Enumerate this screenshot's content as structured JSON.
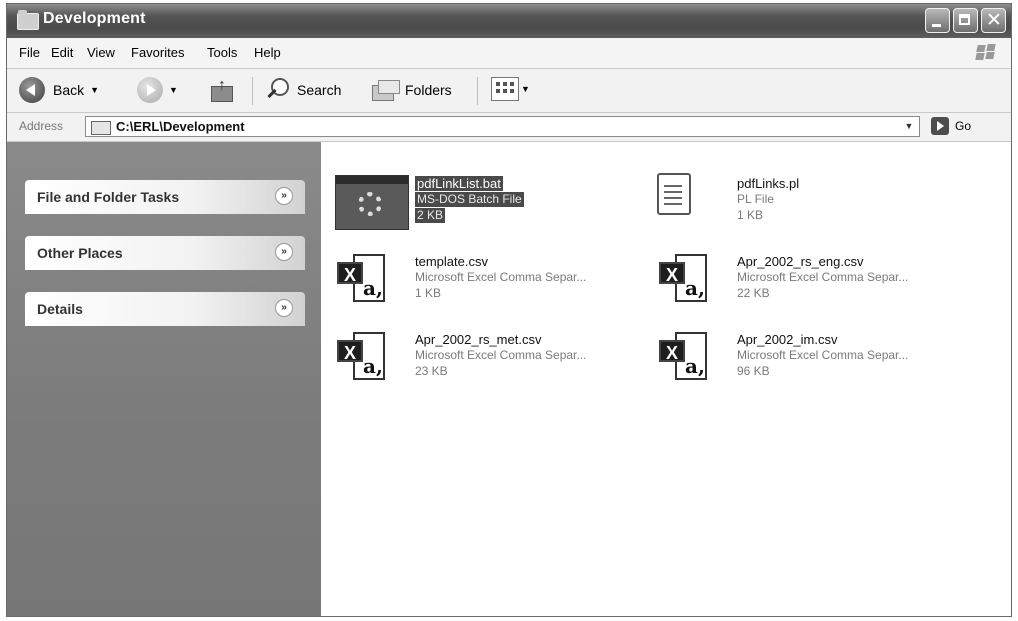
{
  "window": {
    "title": "Development"
  },
  "menu": [
    "File",
    "Edit",
    "View",
    "Favorites",
    "Tools",
    "Help"
  ],
  "toolbar": {
    "back": "Back",
    "search": "Search",
    "folders": "Folders"
  },
  "address": {
    "label": "Address",
    "path": "C:\\ERL\\Development",
    "go": "Go"
  },
  "tasks": [
    "File and Folder Tasks",
    "Other Places",
    "Details"
  ],
  "files": [
    {
      "name": "pdfLinkList.bat",
      "type": "MS-DOS Batch File",
      "size": "2 KB",
      "icon": "batch-file-icon",
      "selected": true
    },
    {
      "name": "pdfLinks.pl",
      "type": "PL File",
      "size": "1 KB",
      "icon": "text-file-icon"
    },
    {
      "name": "template.csv",
      "type": "Microsoft Excel Comma Separ...",
      "size": "1 KB",
      "icon": "excel-csv-icon"
    },
    {
      "name": "Apr_2002_rs_eng.csv",
      "type": "Microsoft Excel Comma Separ...",
      "size": "22 KB",
      "icon": "excel-csv-icon"
    },
    {
      "name": "Apr_2002_rs_met.csv",
      "type": "Microsoft Excel Comma Separ...",
      "size": "23 KB",
      "icon": "excel-csv-icon"
    },
    {
      "name": "Apr_2002_im.csv",
      "type": "Microsoft Excel Comma Separ...",
      "size": "96 KB",
      "icon": "excel-csv-icon"
    }
  ]
}
